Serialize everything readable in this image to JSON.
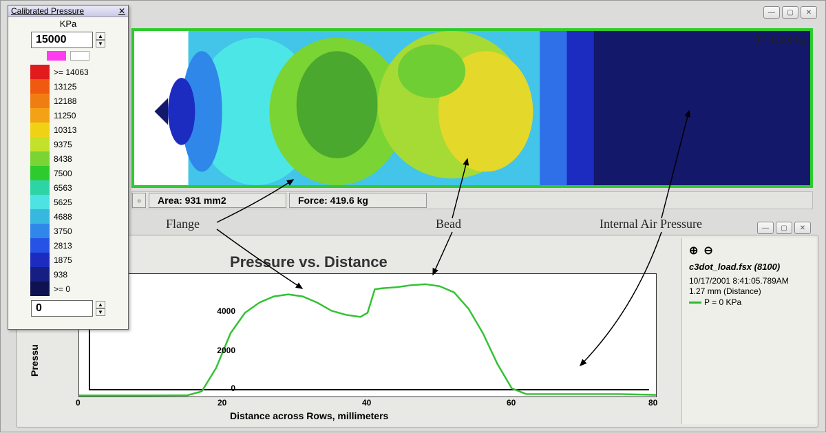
{
  "legend": {
    "title": "Calibrated Pressure",
    "unit": "KPa",
    "max_value": "15000",
    "min_value": "0",
    "stops": [
      {
        "label": ">= 14063",
        "color": "#e11b1b"
      },
      {
        "label": "13125",
        "color": "#f05a10"
      },
      {
        "label": "12188",
        "color": "#f07d12"
      },
      {
        "label": "11250",
        "color": "#f3a216"
      },
      {
        "label": "10313",
        "color": "#f0d215"
      },
      {
        "label": "9375",
        "color": "#c3e02b"
      },
      {
        "label": "8438",
        "color": "#7ad433"
      },
      {
        "label": "7500",
        "color": "#2ecb2e"
      },
      {
        "label": "6563",
        "color": "#2dd4a6"
      },
      {
        "label": "5625",
        "color": "#4ee2e2"
      },
      {
        "label": "4688",
        "color": "#38b7df"
      },
      {
        "label": "3750",
        "color": "#2f87ea"
      },
      {
        "label": "2813",
        "color": "#2653e6"
      },
      {
        "label": "1875",
        "color": "#1c2cc0"
      },
      {
        "label": "938",
        "color": "#171e82"
      },
      {
        "label": ">= 0",
        "color": "#0f1250"
      }
    ]
  },
  "status": {
    "area": "Area: 931 mm2",
    "force": "Force: 419.6 kg"
  },
  "force_badge": "(F) 419.6 kg",
  "annotations": {
    "flange": "Flange",
    "bead": "Bead",
    "air": "Internal Air Pressure"
  },
  "sidebar": {
    "file": "c3dot_load.fsx (8100)",
    "timestamp": "10/17/2001 8:41:05.789AM",
    "distance": "1.27 mm (Distance)",
    "legend": "P = 0 KPa"
  },
  "chart_data": {
    "type": "line",
    "title": "Pressure vs. Distance",
    "xlabel": "Distance across Rows, millimeters",
    "ylabel": "Pressu",
    "xlim": [
      0,
      80
    ],
    "ylim": [
      0,
      6000
    ],
    "xticks": [
      0,
      20,
      40,
      60,
      80
    ],
    "yticks": [
      0,
      2000,
      4000
    ],
    "series": [
      {
        "name": "P = 0 KPa",
        "color": "#33c233",
        "x": [
          0,
          5,
          10,
          15,
          17,
          19,
          21,
          23,
          25,
          27,
          29,
          31,
          33,
          35,
          37,
          39,
          40,
          41,
          42,
          44,
          46,
          48,
          50,
          52,
          54,
          56,
          58,
          60,
          62,
          65,
          70,
          75,
          80
        ],
        "y": [
          50,
          50,
          50,
          60,
          250,
          1400,
          3100,
          4100,
          4600,
          4900,
          5000,
          4900,
          4600,
          4200,
          4000,
          3900,
          4100,
          5250,
          5300,
          5350,
          5450,
          5500,
          5400,
          5100,
          4300,
          3100,
          1600,
          400,
          120,
          120,
          120,
          120,
          80
        ]
      }
    ]
  }
}
